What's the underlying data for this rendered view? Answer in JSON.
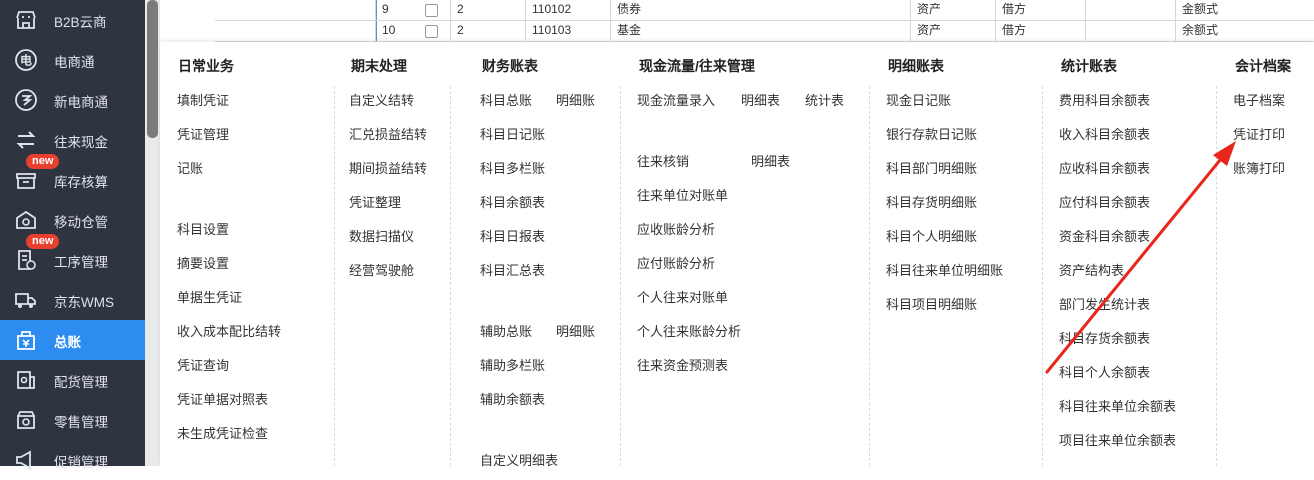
{
  "sidebar": {
    "items": [
      {
        "label": "B2B云商",
        "icon": "store-icon"
      },
      {
        "label": "电商通",
        "icon": "ecommerce-icon"
      },
      {
        "label": "新电商通",
        "icon": "new-ecommerce-icon"
      },
      {
        "label": "往来现金",
        "icon": "exchange-icon"
      },
      {
        "label": "库存核算",
        "icon": "inventory-icon",
        "badge": "new"
      },
      {
        "label": "移动仓管",
        "icon": "warehouse-icon"
      },
      {
        "label": "工序管理",
        "icon": "process-icon",
        "badge": "new"
      },
      {
        "label": "京东WMS",
        "icon": "truck-icon"
      },
      {
        "label": "总账",
        "icon": "ledger-icon",
        "active": true
      },
      {
        "label": "配货管理",
        "icon": "distribution-icon"
      },
      {
        "label": "零售管理",
        "icon": "retail-icon"
      },
      {
        "label": "促销管理",
        "icon": "promotion-icon"
      }
    ]
  },
  "table": {
    "rows": [
      {
        "num": "9",
        "level": "2",
        "code": "110102",
        "name": "债券",
        "type": "资产",
        "direction": "借方",
        "format": "金额式"
      },
      {
        "num": "10",
        "level": "2",
        "code": "110103",
        "name": "基金",
        "type": "资产",
        "direction": "借方",
        "format": "余额式"
      }
    ]
  },
  "menu": {
    "columns": [
      {
        "title": "日常业务",
        "items": [
          "填制凭证",
          "凭证管理",
          "记账",
          "科目设置",
          "摘要设置",
          "单据生凭证",
          "收入成本配比结转",
          "凭证查询",
          "凭证单据对照表",
          "未生成凭证检查"
        ]
      },
      {
        "title": "期末处理",
        "items": [
          "自定义结转",
          "汇兑损益结转",
          "期间损益结转",
          "凭证整理",
          "数据扫描仪",
          "经营驾驶舱"
        ]
      },
      {
        "title": "财务账表",
        "items": [
          "科目总账",
          "明细账",
          "科目日记账",
          "科目多栏账",
          "科目余额表",
          "科目日报表",
          "科目汇总表",
          "辅助总账",
          "明细账",
          "辅助多栏账",
          "辅助余额表",
          "自定义明细表"
        ]
      },
      {
        "title": "现金流量/往来管理",
        "items": [
          "现金流量录入",
          "明细表",
          "统计表",
          "往来核销",
          "明细表",
          "往来单位对账单",
          "应收账龄分析",
          "应付账龄分析",
          "个人往来对账单",
          "个人往来账龄分析",
          "往来资金预测表"
        ]
      },
      {
        "title": "明细账表",
        "items": [
          "现金日记账",
          "银行存款日记账",
          "科目部门明细账",
          "科目存货明细账",
          "科目个人明细账",
          "科目往来单位明细账",
          "科目项目明细账"
        ]
      },
      {
        "title": "统计账表",
        "items": [
          "费用科目余额表",
          "收入科目余额表",
          "应收科目余额表",
          "应付科目余额表",
          "资金科目余额表",
          "资产结构表",
          "部门发生统计表",
          "科目存货余额表",
          "科目个人余额表",
          "科目往来单位余额表",
          "项目往来单位余额表"
        ]
      },
      {
        "title": "会计档案",
        "items": [
          "电子档案",
          "凭证打印",
          "账簿打印"
        ]
      }
    ]
  },
  "colors": {
    "sidebar_bg": "#2f3441",
    "active_bg": "#2d8cf0",
    "badge": "#e8402f",
    "arrow": "#e8261c"
  }
}
